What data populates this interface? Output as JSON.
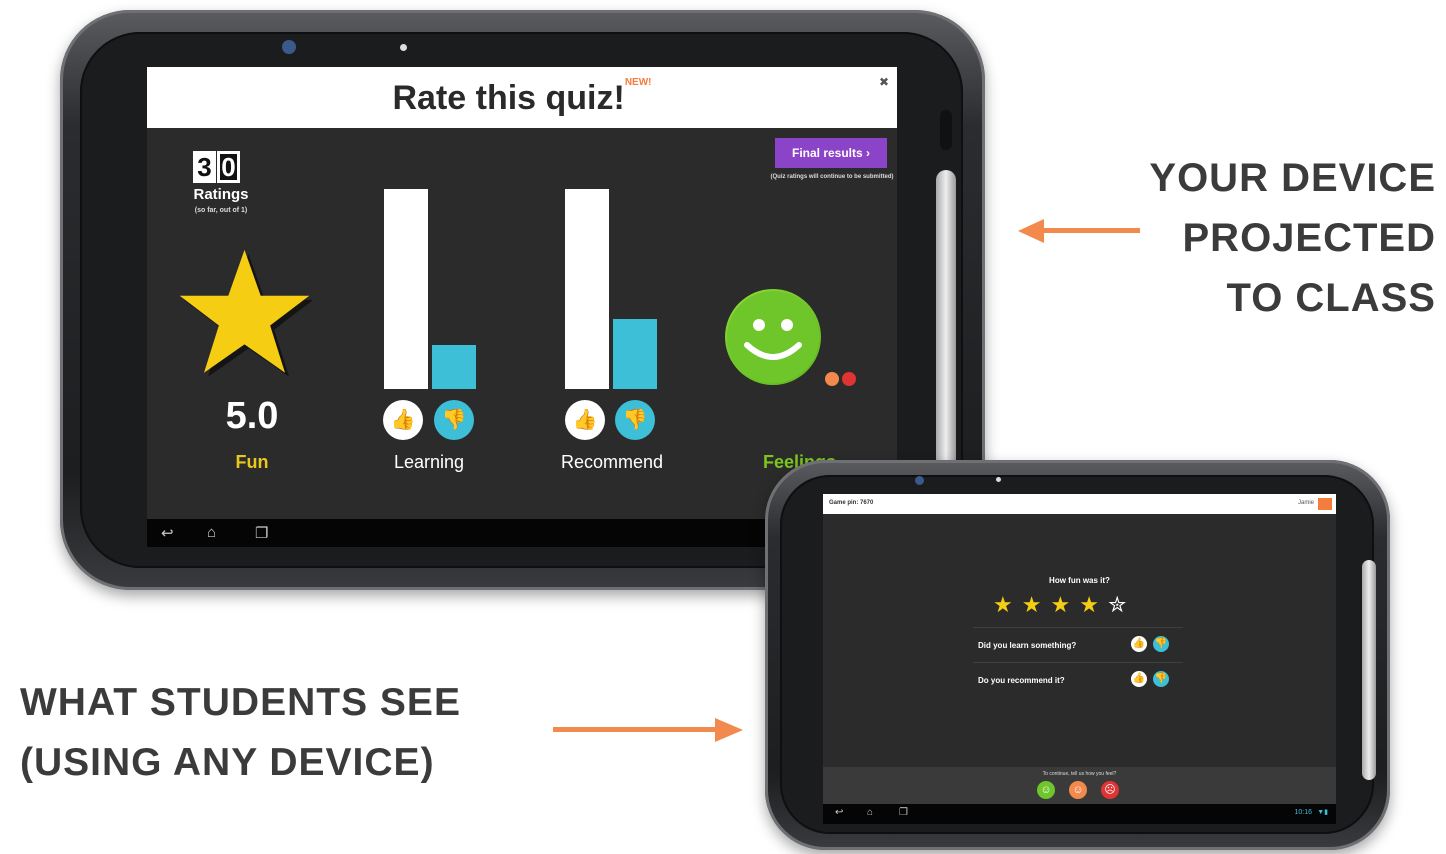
{
  "projector": {
    "title": "Rate this quiz!",
    "new_badge": "NEW!",
    "close_icon": "fullscreen-exit-icon",
    "ratings": {
      "digits": [
        "3",
        "0"
      ],
      "label": "Ratings",
      "sub": "(so far, out of 1)"
    },
    "final_button": "Final results ›",
    "final_note": "(Quiz ratings will continue to be submitted)",
    "metrics": [
      {
        "name": "Fun",
        "score": "5.0",
        "color": "#e8c81a"
      },
      {
        "name": "Learning",
        "thumbs_up_share": 0.8,
        "thumbs_down_share": 0.2,
        "color": "#ffffff"
      },
      {
        "name": "Recommend",
        "thumbs_up_share": 0.7,
        "thumbs_down_share": 0.3,
        "color": "#ffffff"
      },
      {
        "name": "Feelings",
        "color": "#7cc51f"
      }
    ],
    "nav_icons": [
      "back-icon",
      "home-icon",
      "recent-apps-icon"
    ]
  },
  "student": {
    "pin": "Game pin: 7670",
    "user": "Jamie",
    "question_fun": "How fun was it?",
    "stars": {
      "filled": 4,
      "total": 5
    },
    "question_learn": "Did you learn something?",
    "question_recommend": "Do you recommend it?",
    "continue_prompt": "To continue, tell us how you feel?",
    "status_time": "10:16"
  },
  "captions": {
    "projected": [
      "YOUR DEVICE",
      "PROJECTED",
      "TO CLASS"
    ],
    "students": [
      "WHAT STUDENTS SEE",
      "(USING ANY DEVICE)"
    ]
  },
  "colors": {
    "accent_orange": "#f2894d",
    "purple": "#8b44c8",
    "blue": "#3dbfd8",
    "green": "#7cc51f",
    "star": "#f5cd12"
  }
}
